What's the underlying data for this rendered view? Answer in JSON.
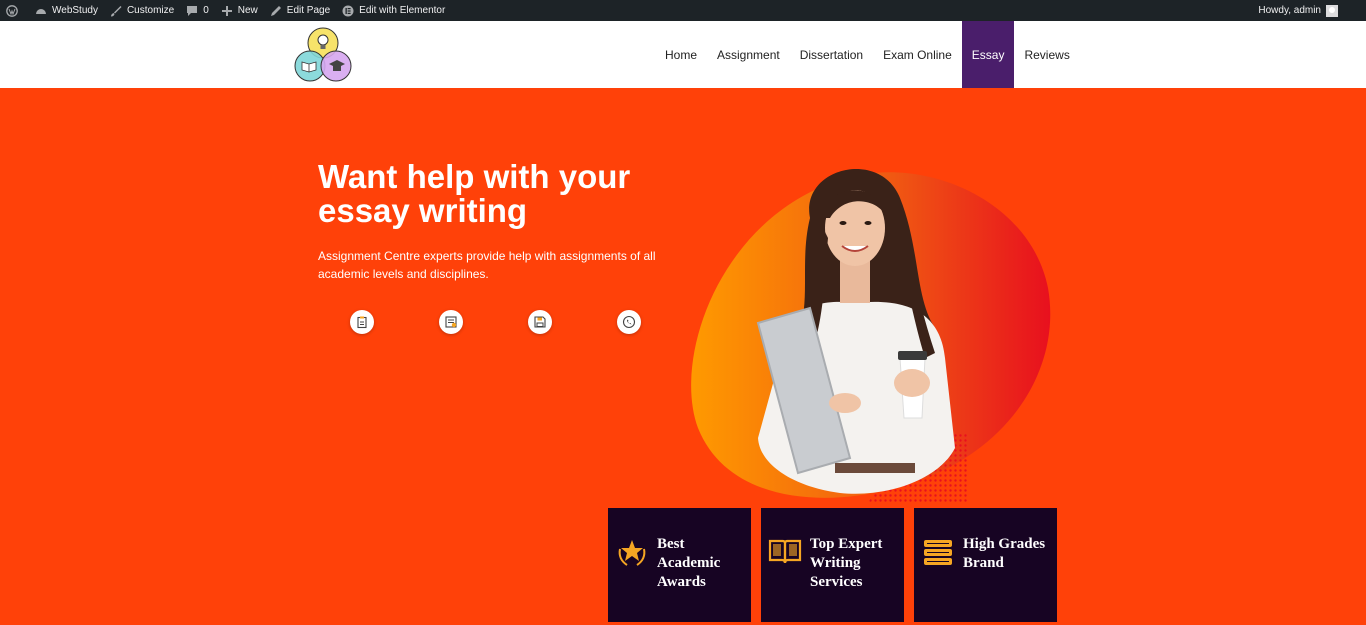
{
  "adminbar": {
    "items": [
      {
        "icon": "wordpress-icon",
        "label": ""
      },
      {
        "icon": "dashboard-icon",
        "label": "WebStudy"
      },
      {
        "icon": "brush-icon",
        "label": "Customize"
      },
      {
        "icon": "comment-icon",
        "label": "0"
      },
      {
        "icon": "plus-icon",
        "label": "New"
      },
      {
        "icon": "pencil-icon",
        "label": "Edit Page"
      },
      {
        "icon": "elementor-icon",
        "label": "Edit with Elementor"
      }
    ],
    "greeting": "Howdy, admin"
  },
  "nav": {
    "items": [
      "Home",
      "Assignment",
      "Dissertation",
      "Exam Online",
      "Essay",
      "Reviews"
    ],
    "active": "Essay"
  },
  "hero": {
    "title": "Want help with your essay writing",
    "subtitle": "Assignment Centre experts provide help with assignments of all academic levels and disciplines.",
    "icons": [
      "clipboard-icon",
      "document-icon",
      "save-icon",
      "phone-icon"
    ]
  },
  "cards": [
    {
      "icon": "award-star-icon",
      "label": "Best Academic Awards"
    },
    {
      "icon": "open-book-icon",
      "label": "Top Expert Writing Services"
    },
    {
      "icon": "book-stack-icon",
      "label": "High Grades Brand"
    }
  ],
  "colors": {
    "accent": "#ff4109",
    "nav_active": "#4a1e6b",
    "card_bg": "#170423",
    "card_icon": "#f5a623"
  }
}
